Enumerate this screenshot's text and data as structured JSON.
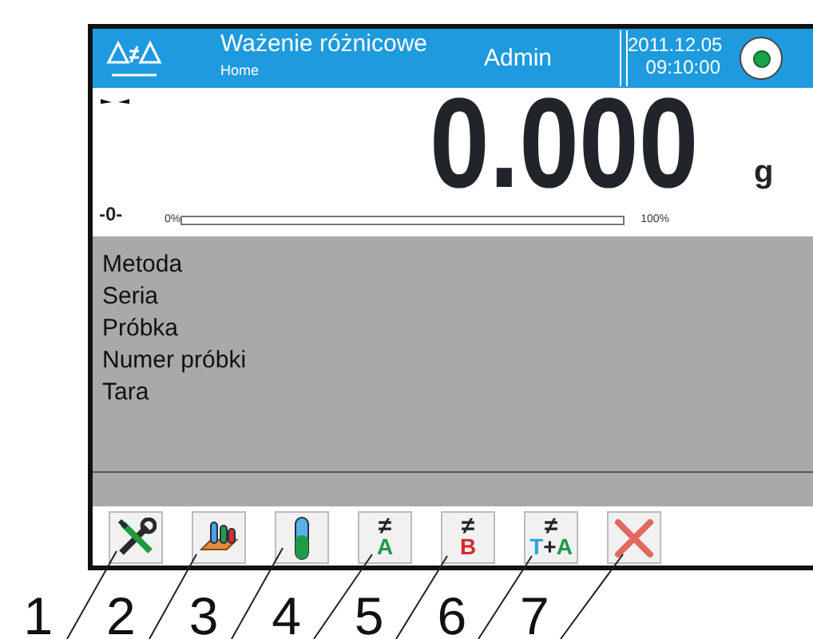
{
  "header": {
    "title": "Ważenie różnicowe",
    "subtitle": "Home",
    "user": "Admin",
    "date": "2011.12.05",
    "time": "09:10:00"
  },
  "weighing": {
    "zero_indicator": "-0-",
    "value": "0.000",
    "unit": "g",
    "bar": {
      "min_label": "0%",
      "max_label": "100%",
      "level": 0
    }
  },
  "info_lines": [
    "Metoda",
    "Seria",
    "Próbka",
    "Numer próbki",
    "Tara"
  ],
  "toolbar": [
    {
      "kind": "tools"
    },
    {
      "kind": "database"
    },
    {
      "kind": "tube"
    },
    {
      "kind": "diff",
      "symbol": "≠",
      "parts": [
        {
          "text": "A",
          "color": "#1d9a45"
        }
      ]
    },
    {
      "kind": "diff",
      "symbol": "≠",
      "parts": [
        {
          "text": "B",
          "color": "#d9262b"
        }
      ]
    },
    {
      "kind": "diff",
      "symbol": "≠",
      "parts": [
        {
          "text": "T",
          "color": "#2aa3e3"
        },
        {
          "text": "+",
          "color": "#222222"
        },
        {
          "text": "A",
          "color": "#1d9a45"
        }
      ]
    },
    {
      "kind": "crossed"
    }
  ],
  "callouts": [
    "1",
    "2",
    "3",
    "4",
    "5",
    "6",
    "7"
  ]
}
